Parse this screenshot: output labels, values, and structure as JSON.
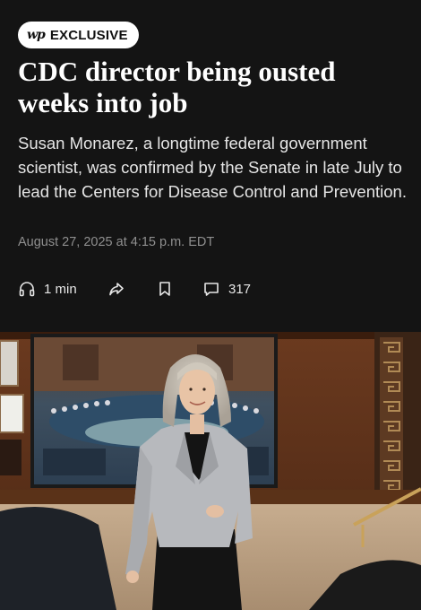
{
  "badge": {
    "logo": "wp",
    "label": "EXCLUSIVE"
  },
  "headline": "CDC director being ousted weeks into job",
  "dek": "Susan Monarez, a longtime federal government scientist, was confirmed by the Senate in late July to lead the Centers for Disease Control and Prevention.",
  "dateline": "August 27, 2025 at 4:15 p.m. EDT",
  "actions": {
    "listen_duration": "1 min",
    "comment_count": "317"
  },
  "icons": {
    "listen": "headphones-icon",
    "share": "share-arrow-icon",
    "save": "bookmark-icon",
    "comments": "comment-bubble-icon"
  },
  "colors": {
    "background": "#141414",
    "headline": "#ffffff",
    "dek": "#e6e6e6",
    "dateline": "#8f8f8f",
    "badge_bg": "#ffffff"
  }
}
